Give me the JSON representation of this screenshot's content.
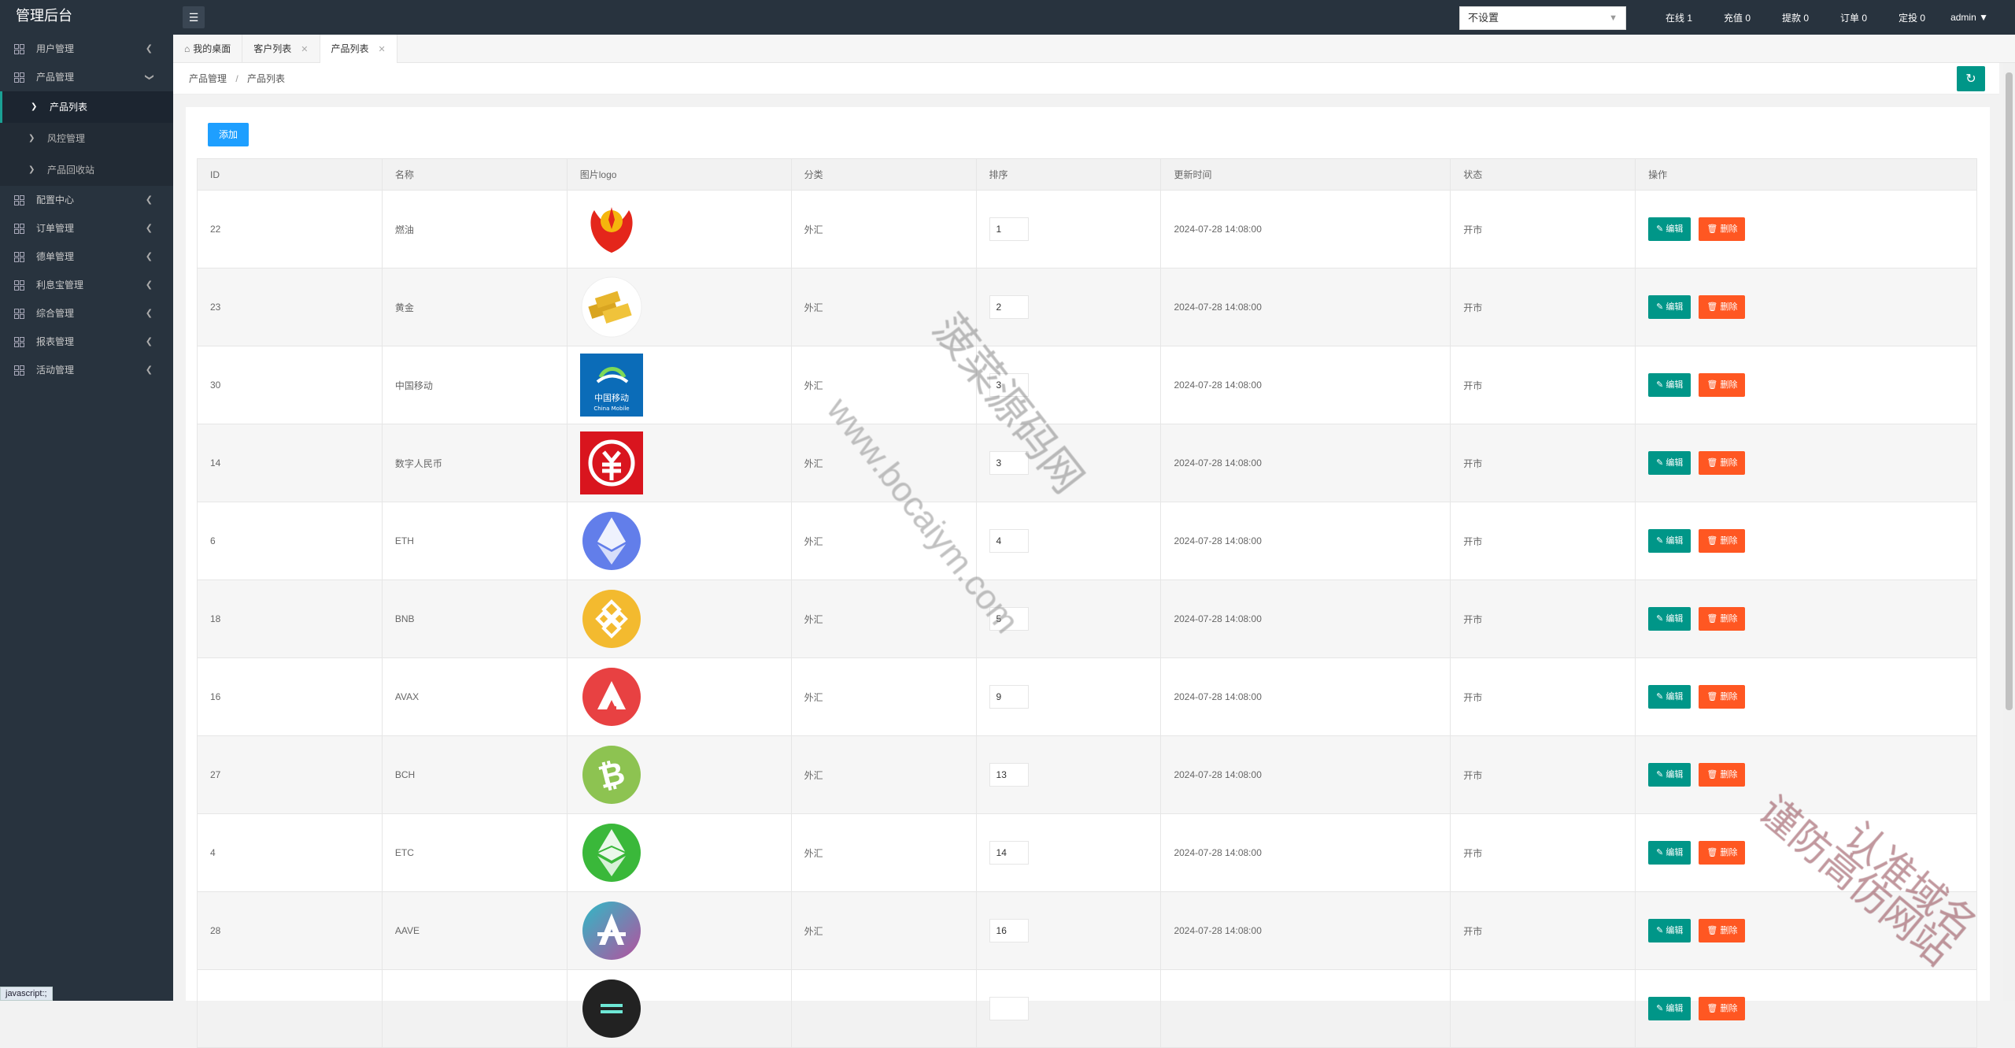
{
  "app": {
    "title": "管理后台"
  },
  "sidebar": {
    "items": [
      {
        "label": "用户管理",
        "open": false
      },
      {
        "label": "产品管理",
        "open": true
      },
      {
        "label": "配置中心",
        "open": false
      },
      {
        "label": "订单管理",
        "open": false
      },
      {
        "label": "德单管理",
        "open": false
      },
      {
        "label": "利息宝管理",
        "open": false
      },
      {
        "label": "综合管理",
        "open": false
      },
      {
        "label": "报表管理",
        "open": false
      },
      {
        "label": "活动管理",
        "open": false
      }
    ],
    "sub_items": [
      {
        "label": "产品列表",
        "active": true
      },
      {
        "label": "风控管理",
        "active": false
      },
      {
        "label": "产品回收站",
        "active": false
      }
    ]
  },
  "topbar": {
    "select_value": "不设置",
    "stats": [
      "在线 1",
      "充值 0",
      "提款 0",
      "订单 0",
      "定投 0"
    ],
    "user": "admin"
  },
  "tabs": [
    {
      "label": "我的桌面",
      "closable": false,
      "active": false
    },
    {
      "label": "客户列表",
      "closable": true,
      "active": false
    },
    {
      "label": "产品列表",
      "closable": true,
      "active": true
    }
  ],
  "breadcrumb": [
    "产品管理",
    "产品列表"
  ],
  "toolbar": {
    "add_label": "添加"
  },
  "table": {
    "headers": [
      "ID",
      "名称",
      "图片logo",
      "分类",
      "排序",
      "更新时间",
      "状态",
      "操作"
    ],
    "edit_label": "编辑",
    "delete_label": "删除",
    "rows": [
      {
        "id": "22",
        "name": "燃油",
        "logo": "petrochina-logo",
        "category": "外汇",
        "sort": "1",
        "updated": "2024-07-28 14:08:00",
        "status": "开市"
      },
      {
        "id": "23",
        "name": "黄金",
        "logo": "gold-bars-logo",
        "category": "外汇",
        "sort": "2",
        "updated": "2024-07-28 14:08:00",
        "status": "开市"
      },
      {
        "id": "30",
        "name": "中国移动",
        "logo": "china-mobile-logo",
        "category": "外汇",
        "sort": "3",
        "updated": "2024-07-28 14:08:00",
        "status": "开市"
      },
      {
        "id": "14",
        "name": "数字人民币",
        "logo": "digital-rmb-logo",
        "category": "外汇",
        "sort": "3",
        "updated": "2024-07-28 14:08:00",
        "status": "开市"
      },
      {
        "id": "6",
        "name": "ETH",
        "logo": "eth-logo",
        "category": "外汇",
        "sort": "4",
        "updated": "2024-07-28 14:08:00",
        "status": "开市"
      },
      {
        "id": "18",
        "name": "BNB",
        "logo": "bnb-logo",
        "category": "外汇",
        "sort": "5",
        "updated": "2024-07-28 14:08:00",
        "status": "开市"
      },
      {
        "id": "16",
        "name": "AVAX",
        "logo": "avax-logo",
        "category": "外汇",
        "sort": "9",
        "updated": "2024-07-28 14:08:00",
        "status": "开市"
      },
      {
        "id": "27",
        "name": "BCH",
        "logo": "bch-logo",
        "category": "外汇",
        "sort": "13",
        "updated": "2024-07-28 14:08:00",
        "status": "开市"
      },
      {
        "id": "4",
        "name": "ETC",
        "logo": "etc-logo",
        "category": "外汇",
        "sort": "14",
        "updated": "2024-07-28 14:08:00",
        "status": "开市"
      },
      {
        "id": "28",
        "name": "AAVE",
        "logo": "aave-logo",
        "category": "外汇",
        "sort": "16",
        "updated": "2024-07-28 14:08:00",
        "status": "开市"
      },
      {
        "id": "",
        "name": "",
        "logo": "partial-logo",
        "category": "",
        "sort": "",
        "updated": "",
        "status": ""
      }
    ]
  },
  "status_tip": "javascript:;",
  "watermarks": [
    "菠菜源码网",
    "www.bocaiym.com",
    "认准域名",
    "谨防高仿网站"
  ],
  "colors": {
    "sidebar": "#28333e",
    "accent": "#009688",
    "danger": "#ff5722",
    "primary": "#1e9fff"
  }
}
